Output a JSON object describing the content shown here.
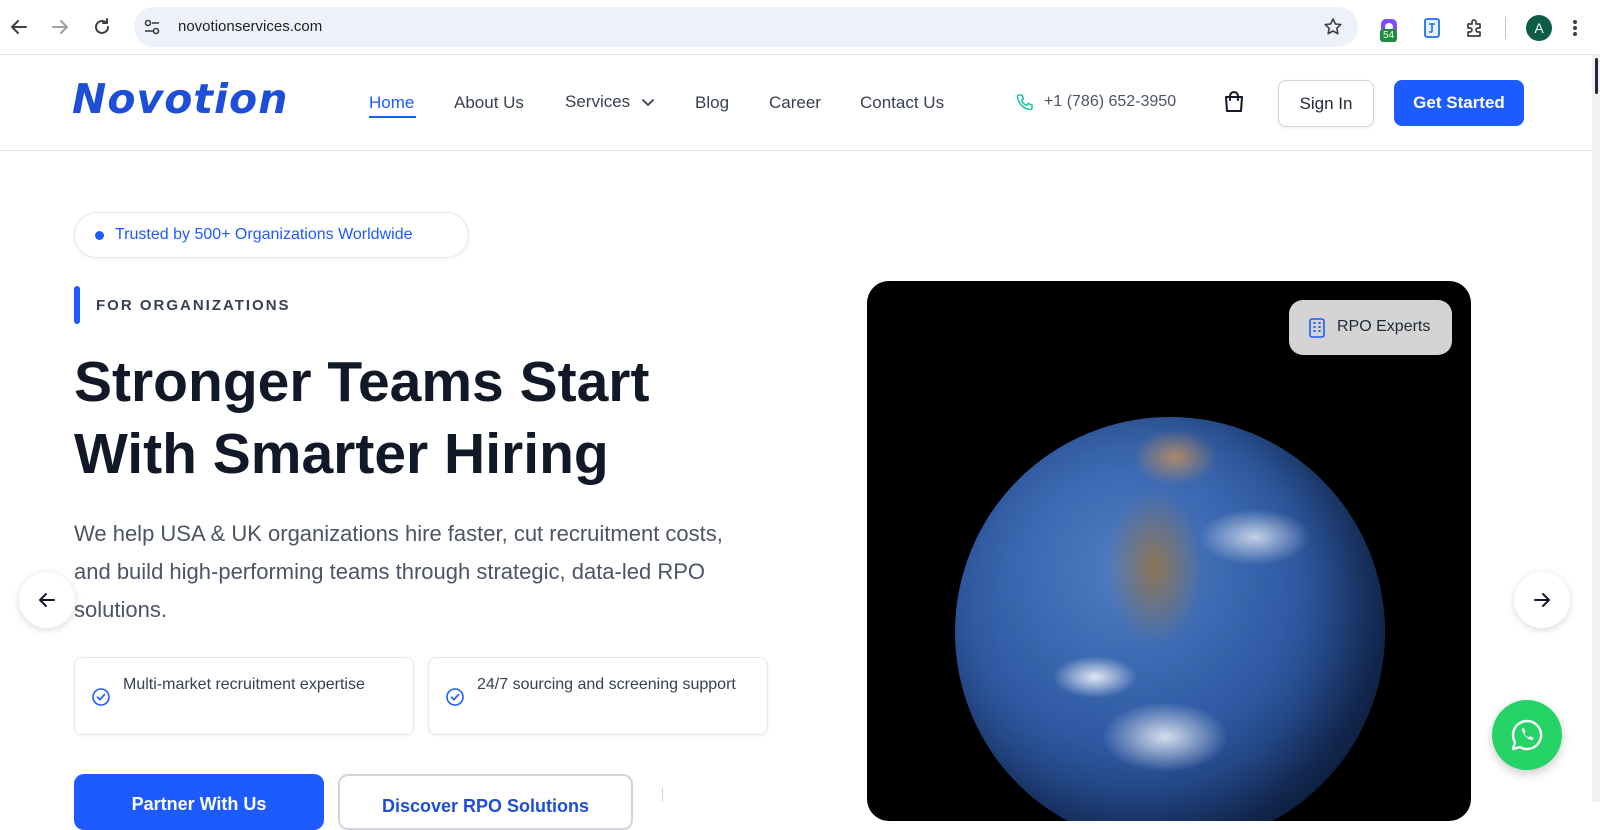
{
  "browser": {
    "url": "novotionservices.com",
    "extension_badge": "54",
    "profile_initial": "A",
    "icons": [
      "back-arrow-icon",
      "forward-arrow-icon",
      "reload-icon",
      "site-settings-icon",
      "bookmark-star-icon",
      "puzzle-icon",
      "kebab-menu-icon"
    ]
  },
  "header": {
    "logo": "Novotion",
    "nav": [
      {
        "label": "Home",
        "active": true
      },
      {
        "label": "About Us"
      },
      {
        "label": "Services",
        "has_dropdown": true
      },
      {
        "label": "Blog"
      },
      {
        "label": "Career"
      },
      {
        "label": "Contact Us"
      }
    ],
    "phone": "+1 (786) 652-3950",
    "sign_in": "Sign In",
    "get_started": "Get Started"
  },
  "hero": {
    "trust_badge": "Trusted by 500+ Organizations Worldwide",
    "eyebrow": "FOR ORGANIZATIONS",
    "headline_line1": "Stronger Teams Start",
    "headline_line2": "With Smarter Hiring",
    "subtext": "We help USA & UK organizations hire faster, cut recruitment costs, and build high-performing teams through strategic, data-led RPO solutions.",
    "features": [
      {
        "text": "Multi-market recruitment expertise"
      },
      {
        "text": "24/7 sourcing and screening support"
      }
    ],
    "cta_primary": "Partner With Us",
    "cta_secondary": "Discover RPO Solutions",
    "media_badge": "RPO Experts"
  },
  "colors": {
    "brand": "#1d5bff",
    "whatsapp": "#25d366"
  }
}
